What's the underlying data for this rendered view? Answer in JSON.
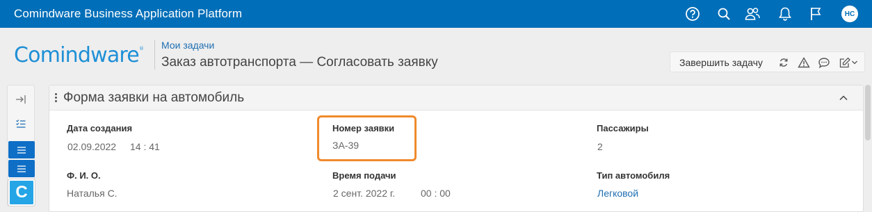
{
  "app": {
    "title": "Comindware Business Application Platform",
    "user_initials": "НС",
    "top_icons": [
      "help-icon",
      "search-icon",
      "users-icon",
      "bell-icon",
      "flag-icon"
    ]
  },
  "header": {
    "logo_text": "Comindware",
    "breadcrumb": "Мои задачи",
    "title": "Заказ автотранспорта — Согласовать заявку",
    "actions": {
      "complete_label": "Завершить задачу",
      "icons": [
        "refresh-icon",
        "warning-icon",
        "comment-icon",
        "edit-icon",
        "chevron-down-icon"
      ]
    }
  },
  "left_toolbar": {
    "icons": [
      "expand-panel-icon",
      "task-list-icon",
      "menu-icon",
      "menu-icon"
    ],
    "app_letter": "C"
  },
  "form": {
    "title": "Форма заявки на автомобиль",
    "fields": {
      "created_label": "Дата создания",
      "created_date": "02.09.2022",
      "created_time": "14 : 41",
      "number_label": "Номер заявки",
      "number_value": "ЗА-39",
      "passengers_label": "Пассажиры",
      "passengers_value": "2",
      "fio_label": "Ф. И. О.",
      "fio_value": "Наталья С.",
      "submit_time_label": "Время подачи",
      "submit_date": "2 сент. 2022 г.",
      "submit_time": "00 : 00",
      "car_type_label": "Тип автомобиля",
      "car_type_value": "Легковой"
    }
  },
  "colors": {
    "topbar": "#006eb8",
    "link": "#1f6fb2",
    "highlight": "#f08a2c",
    "logo": "#1e8fd6"
  }
}
